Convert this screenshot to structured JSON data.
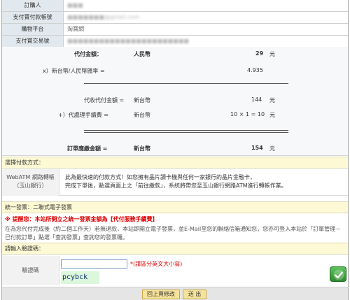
{
  "info": {
    "rows": [
      {
        "label": "訂購人",
        "value": "■■■",
        "blur": true
      },
      {
        "label": "支付寶付款帳號",
        "value": "■■■■■■■@gmail.com",
        "blur": true
      },
      {
        "label": "購物平台",
        "value": "淘寶網",
        "blur": false
      },
      {
        "label": "支付寶交易號",
        "value": "■■■■■■■■■■■■■■■■■■■■■■■",
        "blur": true
      }
    ]
  },
  "amounts": {
    "pay_amount_label": "代付金額：",
    "pay_currency": "人民幣",
    "pay_amount": "29",
    "yuan1": "元",
    "rate_label": "x）新台幣/人民幣匯率 =",
    "rate_value": "4.935",
    "converted_label": "代收代付金額 =",
    "converted_currency": "新台幣",
    "converted_amount": "144",
    "yuan2": "元",
    "fee_label": "+）代處理手續費 =",
    "fee_currency": "新台幣",
    "fee_calc": "10 × 1 = 10",
    "yuan3": "元",
    "total_label": "訂單應繳金額 =",
    "total_currency": "新台幣",
    "total_amount": "154",
    "yuan4": "元"
  },
  "payment": {
    "section_title": "選擇付款方式：",
    "method_label_line1": "WebATM 網路轉帳",
    "method_label_line2": "（玉山銀行）",
    "desc_line1": "此為最快速的付款方式！如您擁有晶片讀卡機與任何一家銀行的晶片金融卡，",
    "desc_line2": "完成下單後，點選頁面上之「前往繳款」，系統將帶您至玉山銀行網路ATM進行轉帳作業。"
  },
  "invoice": {
    "section_title": "統一發票：二聯式電子發票",
    "warning": "※ 提醒您：本站所開立之統一發票金額為【代付服務手續費】",
    "notice": "在為您代付完成後（約二個工作天）若無退款，本站即開立電子發票，並E-Mail至您的聯絡信箱通知您，您亦可登入本站於「訂單管理－已付款訂單」點選「查詢發票」查詢您的發票囉。"
  },
  "captcha": {
    "section_title": "請輸入驗證碼：",
    "label": "驗證碼",
    "input_value": "",
    "hint": "*(請區分英文大小寫)",
    "code": "pcybck"
  },
  "buttons": {
    "back": "回上頁修改",
    "submit": "送 出"
  },
  "colors": {
    "label_bg": "#e2e9ee",
    "section_bg": "#fdf9d4",
    "warning": "#dd0000",
    "button_bg": "#f6e39a"
  }
}
